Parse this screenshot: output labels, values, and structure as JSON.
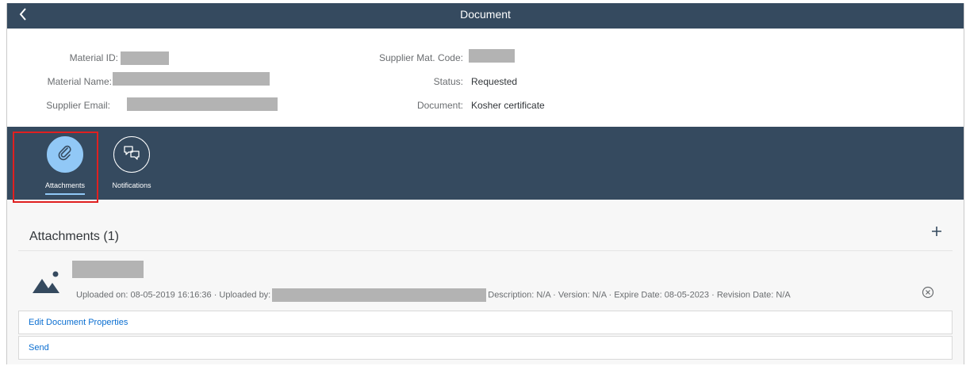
{
  "shell": {
    "title": "Document",
    "back_icon": "chevron-left-icon",
    "bg_color": "#354a5f"
  },
  "header": {
    "left": [
      {
        "label": "Material ID:",
        "value": ""
      },
      {
        "label": "Material Name:",
        "value": ""
      },
      {
        "label": "Supplier Email:",
        "value": ""
      }
    ],
    "right": [
      {
        "label": "Supplier Mat. Code:",
        "value": ""
      },
      {
        "label": "Status:",
        "value": "Requested"
      },
      {
        "label": "Document:",
        "value": "Kosher certificate"
      }
    ]
  },
  "tabs": [
    {
      "label": "Attachments",
      "icon": "paperclip-icon",
      "selected": true
    },
    {
      "label": "Notifications",
      "icon": "chat-bubbles-icon",
      "selected": false
    }
  ],
  "attachments": {
    "title": "Attachments (1)",
    "add_icon": "add-icon",
    "items": [
      {
        "file_name": "",
        "icon": "image-file-icon",
        "uploaded_on_label": "Uploaded on: 08-05-2019 16:16:36 · Uploaded by:",
        "uploaded_by": "",
        "details": "Description: N/A · Version: N/A · Expire Date: 08-05-2023 · Revision Date: N/A",
        "delete_icon": "remove-circle-icon"
      }
    ]
  },
  "actions": [
    {
      "label": "Edit Document Properties"
    },
    {
      "label": "Send"
    }
  ],
  "colors": {
    "accent": "#0a6ed1",
    "selected_tab": "#91c8f6",
    "highlight_border": "#e02020"
  }
}
